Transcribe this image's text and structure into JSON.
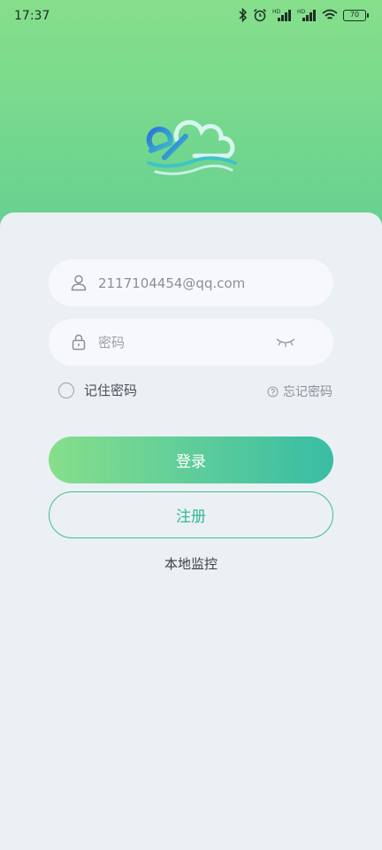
{
  "status_bar": {
    "time": "17:37",
    "signal_1_label": "HD",
    "signal_2_label": "HD",
    "battery": "70",
    "icons": [
      "bluetooth-icon",
      "alarm-icon",
      "signal-icon",
      "signal-icon",
      "wifi-icon",
      "battery-icon"
    ]
  },
  "logo": {
    "icon": "cloud-logo-icon",
    "colors": {
      "blue": "#1f5fd6",
      "teal": "#3fc3c7",
      "light": "#d7f6ef"
    }
  },
  "login_form": {
    "username": {
      "value": "2117104454@qq.com",
      "icon": "user-icon"
    },
    "password": {
      "placeholder": "密码",
      "value": "",
      "icon": "lock-icon",
      "toggle_icon": "eye-closed-icon"
    },
    "remember_label": "记住密码",
    "forgot_label": "忘记密码",
    "forgot_icon": "question-icon",
    "login_label": "登录",
    "register_label": "注册",
    "local_monitor_label": "本地监控"
  },
  "theme": {
    "accent_green": "#86df8b",
    "accent_teal": "#38bda4",
    "background": "#ebf0f4"
  }
}
